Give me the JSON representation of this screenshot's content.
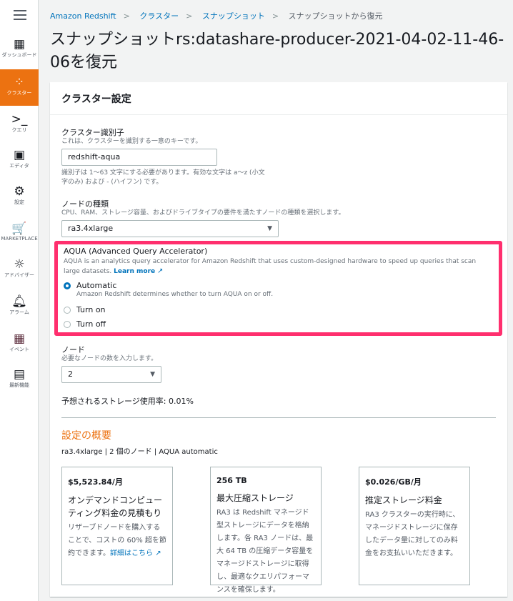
{
  "sidebar": {
    "items": [
      {
        "label": "ダッシュボード",
        "icon": "dashboard-icon"
      },
      {
        "label": "クラスター",
        "icon": "cluster-icon",
        "active": true
      },
      {
        "label": "クエリ",
        "icon": "query-icon"
      },
      {
        "label": "エディタ",
        "icon": "editor-icon"
      },
      {
        "label": "設定",
        "icon": "gear-icon"
      },
      {
        "label": "MARKETPLACE",
        "icon": "cart-icon"
      },
      {
        "label": "アドバイザー",
        "icon": "lightbulb-icon"
      },
      {
        "label": "アラーム",
        "icon": "bell-icon"
      },
      {
        "label": "イベント",
        "icon": "calendar-icon"
      },
      {
        "label": "最新機能",
        "icon": "news-icon"
      }
    ]
  },
  "breadcrumb": [
    "Amazon Redshift",
    "クラスター",
    "スナップショット",
    "スナップショットから復元"
  ],
  "page_title": "スナップショットrs:datashare-producer-2021-04-02-11-46-06を復元",
  "card": {
    "title": "クラスター設定",
    "identifier": {
      "label": "クラスター識別子",
      "desc": "これは、クラスターを識別する一意のキーです。",
      "value": "redshift-aqua",
      "hint": "識別子は 1〜63 文字にする必要があります。有効な文字は a〜z (小文字のみ) および - (ハイフン) です。"
    },
    "node_type": {
      "label": "ノードの種類",
      "desc": "CPU、RAM、ストレージ容量、およびドライブタイプの要件を満たすノードの種類を選択します。",
      "value": "ra3.4xlarge"
    },
    "aqua": {
      "label": "AQUA (Advanced Query Accelerator)",
      "desc": "AQUA is an analytics query accelerator for Amazon Redshift that uses custom-designed hardware to speed up queries that scan large datasets.",
      "learn_more": "Learn more",
      "options": [
        {
          "label": "Automatic",
          "desc": "Amazon Redshift determines whether to turn AQUA on or off.",
          "selected": true
        },
        {
          "label": "Turn on",
          "selected": false
        },
        {
          "label": "Turn off",
          "selected": false
        }
      ]
    },
    "nodes": {
      "label": "ノード",
      "desc": "必要なノードの数を入力します。",
      "value": "2"
    },
    "storage_usage": "予想されるストレージ使用率: 0.01%",
    "summary": {
      "title": "設定の概要",
      "line": "ra3.4xlarge | 2 個のノード | AQUA automatic",
      "cards": [
        {
          "value": "$5,523.84/月",
          "title": "オンデマンドコンピューティング料金の見積もり",
          "desc": "リザーブドノードを購入することで、コストの 60% 超を節約できます。",
          "link": "詳細はこちら"
        },
        {
          "value": "256 TB",
          "title": "最大圧縮ストレージ",
          "desc": "RA3 は Redshift マネージド型ストレージにデータを格納します。各 RA3 ノードは、最大 64 TB の圧縮データ容量をマネージドストレージに取得し、最適なクエリパフォーマンスを確保します。"
        },
        {
          "value": "$0.026/GB/月",
          "title": "推定ストレージ料金",
          "desc": "RA3 クラスターの実行時に、マネージドストレージに保存したデータ量に対してのみ料金をお支払いいただきます。"
        }
      ]
    }
  }
}
